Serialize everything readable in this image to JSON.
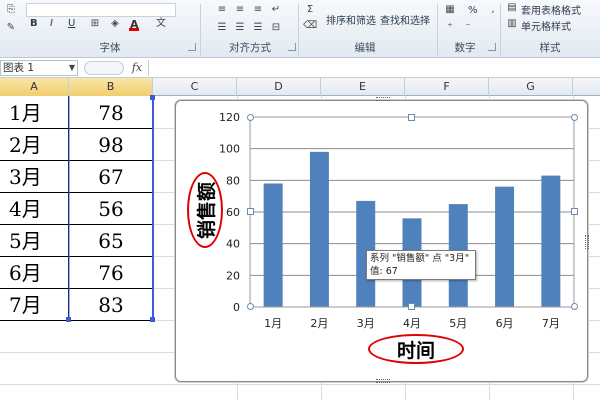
{
  "ribbon": {
    "font_group_label": "字体",
    "align_group_label": "对齐方式",
    "edit_group_label": "编辑",
    "number_group_label": "数字",
    "style_group_label": "样式",
    "sort_filter_label": "排序和筛选",
    "find_select_label": "查找和选择",
    "table_format_label": "套用表格格式",
    "cell_style_label": "单元格样式",
    "percent_label": "%",
    "font_buttons": [
      "B",
      "I",
      "U"
    ]
  },
  "formula_bar": {
    "name_box_value": "图表 1",
    "fx_label": "fx",
    "formula_value": ""
  },
  "columns": [
    "A",
    "B",
    "C",
    "D",
    "E",
    "F",
    "G"
  ],
  "table": {
    "rows": [
      {
        "month": "1月",
        "value": "78"
      },
      {
        "month": "2月",
        "value": "98"
      },
      {
        "month": "3月",
        "value": "67"
      },
      {
        "month": "4月",
        "value": "56"
      },
      {
        "month": "5月",
        "value": "65"
      },
      {
        "month": "6月",
        "value": "76"
      },
      {
        "month": "7月",
        "value": "83"
      }
    ]
  },
  "chart_data": {
    "type": "bar",
    "categories": [
      "1月",
      "2月",
      "3月",
      "4月",
      "5月",
      "6月",
      "7月"
    ],
    "series": [
      {
        "name": "销售额",
        "values": [
          78,
          98,
          67,
          56,
          65,
          76,
          83
        ]
      }
    ],
    "xlabel": "时间",
    "ylabel": "销售额",
    "ylim": [
      0,
      120
    ],
    "yticks": [
      0,
      20,
      40,
      60,
      80,
      100,
      120
    ],
    "grid": true,
    "bar_color": "#4f81bd"
  },
  "tooltip": {
    "line1": "系列 \"销售额\" 点 \"3月\"",
    "line2": "值: 67"
  },
  "colors": {
    "annotation_red": "#e00000",
    "selection_border": "#3b5bdb"
  }
}
